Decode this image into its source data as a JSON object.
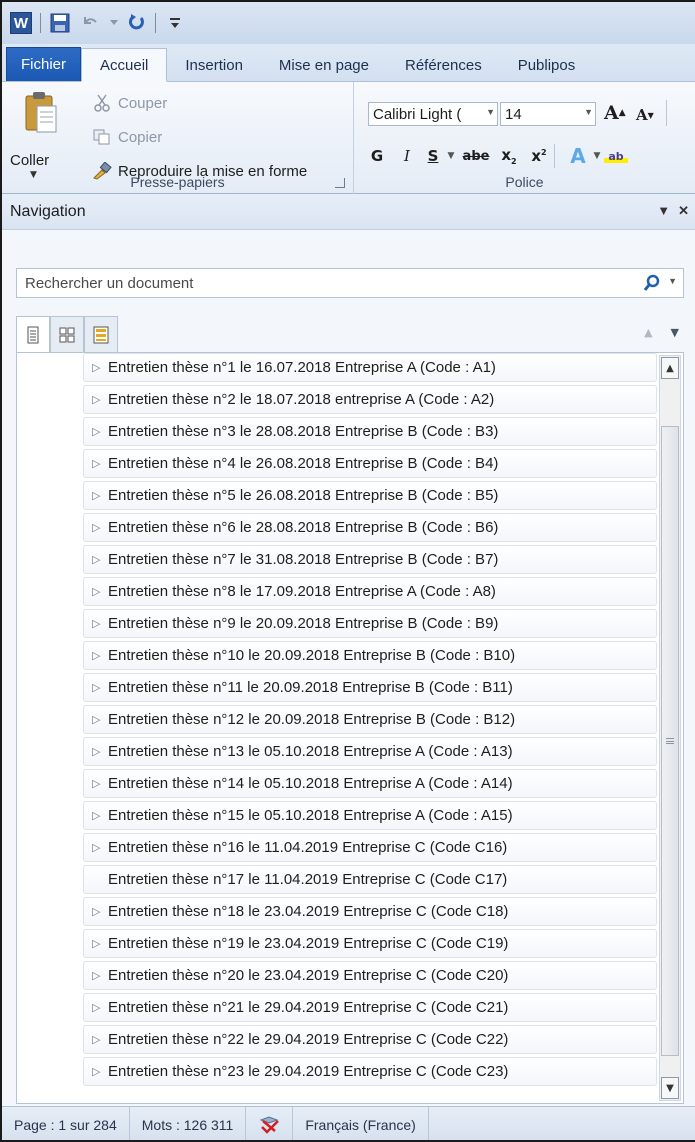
{
  "quick_access": {
    "app_icon_letter": "W"
  },
  "tabs": [
    {
      "label": "Fichier"
    },
    {
      "label": "Accueil"
    },
    {
      "label": "Insertion"
    },
    {
      "label": "Mise en page"
    },
    {
      "label": "Références"
    },
    {
      "label": "Publipos"
    }
  ],
  "clipboard": {
    "paste_label": "Coller",
    "cut_label": "Couper",
    "copy_label": "Copier",
    "format_painter_label": "Reproduire la mise en forme",
    "group_label": "Presse-papiers"
  },
  "font": {
    "font_name": "Calibri Light (",
    "font_size": "14",
    "grow_glyph": "A",
    "shrink_glyph": "A",
    "bold": "G",
    "italic": "I",
    "underline": "S",
    "strike": "abe",
    "subscript": "x",
    "superscript": "x",
    "effects_glyph": "A",
    "highlight_glyph": "ab",
    "group_label": "Police"
  },
  "navigation": {
    "title": "Navigation",
    "search_placeholder": "Rechercher un document",
    "headings": [
      {
        "text": "Entretien thèse n°1 le 16.07.2018 Entreprise A (Code : A1)",
        "expandable": true
      },
      {
        "text": "Entretien thèse n°2 le 18.07.2018 entreprise A (Code : A2)",
        "expandable": true
      },
      {
        "text": "Entretien thèse n°3 le 28.08.2018 Entreprise B (Code : B3)",
        "expandable": true
      },
      {
        "text": "Entretien thèse n°4 le 26.08.2018 Entreprise B (Code : B4)",
        "expandable": true
      },
      {
        "text": "Entretien thèse n°5 le 26.08.2018 Entreprise B (Code : B5)",
        "expandable": true
      },
      {
        "text": "Entretien thèse n°6 le 28.08.2018 Entreprise B (Code : B6)",
        "expandable": true
      },
      {
        "text": "Entretien thèse n°7 le 31.08.2018 Entreprise B (Code : B7)",
        "expandable": true
      },
      {
        "text": "Entretien thèse n°8 le 17.09.2018 Entreprise A (Code : A8)",
        "expandable": true
      },
      {
        "text": "Entretien thèse n°9 le 20.09.2018 Entreprise B (Code : B9)",
        "expandable": true
      },
      {
        "text": "Entretien thèse n°10 le 20.09.2018 Entreprise B (Code : B10)",
        "expandable": true
      },
      {
        "text": "Entretien thèse n°11 le 20.09.2018 Entreprise B (Code : B11)",
        "expandable": true
      },
      {
        "text": "Entretien thèse n°12 le 20.09.2018 Entreprise B (Code : B12)",
        "expandable": true
      },
      {
        "text": "Entretien thèse n°13 le 05.10.2018 Entreprise A (Code : A13)",
        "expandable": true
      },
      {
        "text": "Entretien thèse n°14 le 05.10.2018 Entreprise A (Code : A14)",
        "expandable": true
      },
      {
        "text": "Entretien thèse n°15 le 05.10.2018 Entreprise A (Code : A15)",
        "expandable": true
      },
      {
        "text": "Entretien thèse n°16 le 11.04.2019 Entreprise C (Code C16)",
        "expandable": true
      },
      {
        "text": "Entretien thèse n°17 le 11.04.2019 Entreprise C (Code C17)",
        "expandable": false
      },
      {
        "text": "Entretien thèse n°18 le 23.04.2019 Entreprise C (Code C18)",
        "expandable": true
      },
      {
        "text": "Entretien thèse n°19 le 23.04.2019 Entreprise C (Code C19)",
        "expandable": true
      },
      {
        "text": "Entretien thèse n°20 le 23.04.2019 Entreprise C (Code C20)",
        "expandable": true
      },
      {
        "text": "Entretien thèse n°21 le 29.04.2019 Entreprise C (Code C21)",
        "expandable": true
      },
      {
        "text": "Entretien thèse n°22 le 29.04.2019 Entreprise C (Code C22)",
        "expandable": true
      },
      {
        "text": "Entretien thèse n°23 le 29.04.2019 Entreprise C (Code C23)",
        "expandable": true
      }
    ]
  },
  "status_bar": {
    "page": "Page : 1 sur 284",
    "words": "Mots : 126 311",
    "language": "Français (France)"
  },
  "colors": {
    "file_tab": "#1b58b3",
    "word_brand": "#2b579a",
    "search_icon": "#1f5fb0"
  },
  "icons": [
    "word-logo-icon",
    "save-icon",
    "undo-icon",
    "redo-icon",
    "customize-qat-icon",
    "paste-icon",
    "scissors-icon",
    "copy-icon",
    "format-painter-icon",
    "search-icon",
    "headings-view-icon",
    "pages-view-icon",
    "results-view-icon",
    "spelling-icon"
  ]
}
